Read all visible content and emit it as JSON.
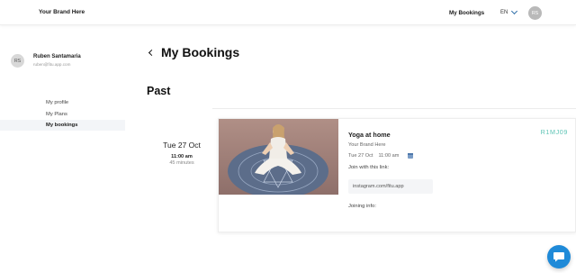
{
  "navbar": {
    "brand": "Your Brand Here",
    "bookings_link": "My Bookings",
    "language": "EN",
    "avatar_initials": "RS"
  },
  "sidebar": {
    "user": {
      "initials": "RS",
      "name": "Ruben Santamaria",
      "email": "ruben@fitu.app.com"
    },
    "items": [
      {
        "label": "My profile",
        "active": false
      },
      {
        "label": "My Plans",
        "active": false
      },
      {
        "label": "My bookings",
        "active": true
      }
    ]
  },
  "main": {
    "title": "My Bookings",
    "section": "Past",
    "booking": {
      "date": "Tue 27 Oct",
      "time": "11:00 am",
      "duration": "45 minutes",
      "title": "Yoga at home",
      "brand": "Your Brand Here",
      "card_date": "Tue 27 Oct",
      "card_time": "11:00 am",
      "join_label": "Join with this link:",
      "join_link": "instagram.com/fitu.app",
      "joining_info_label": "Joining info:",
      "code": "R1MJ09"
    }
  },
  "colors": {
    "accent": "#2f6ea8",
    "code": "#5ec4b5",
    "chat": "#1f8ad8"
  },
  "icons": {
    "back": "chevron-left-icon",
    "language": "chevron-down-icon",
    "calendar": "calendar-icon",
    "chat": "chat-icon"
  }
}
